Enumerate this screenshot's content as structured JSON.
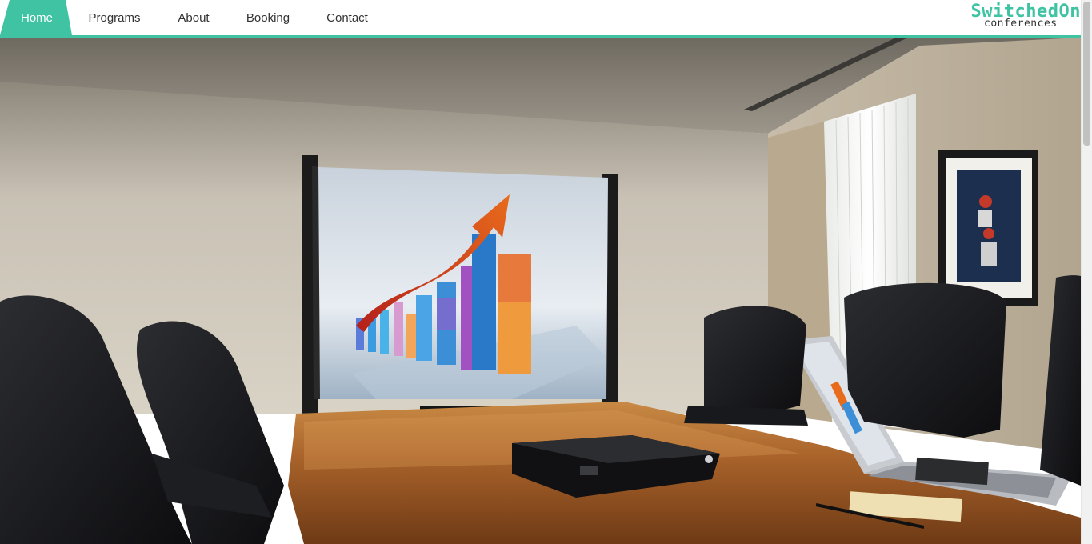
{
  "nav": {
    "items": [
      {
        "label": "Home",
        "active": true
      },
      {
        "label": "Programs",
        "active": false
      },
      {
        "label": "About",
        "active": false
      },
      {
        "label": "Booking",
        "active": false
      },
      {
        "label": "Contact",
        "active": false
      }
    ],
    "accent_color": "#3fc3a3"
  },
  "logo": {
    "line1": "SwitchedOn",
    "line2": "conferences"
  },
  "hero": {
    "image": "conference-room-photo"
  }
}
